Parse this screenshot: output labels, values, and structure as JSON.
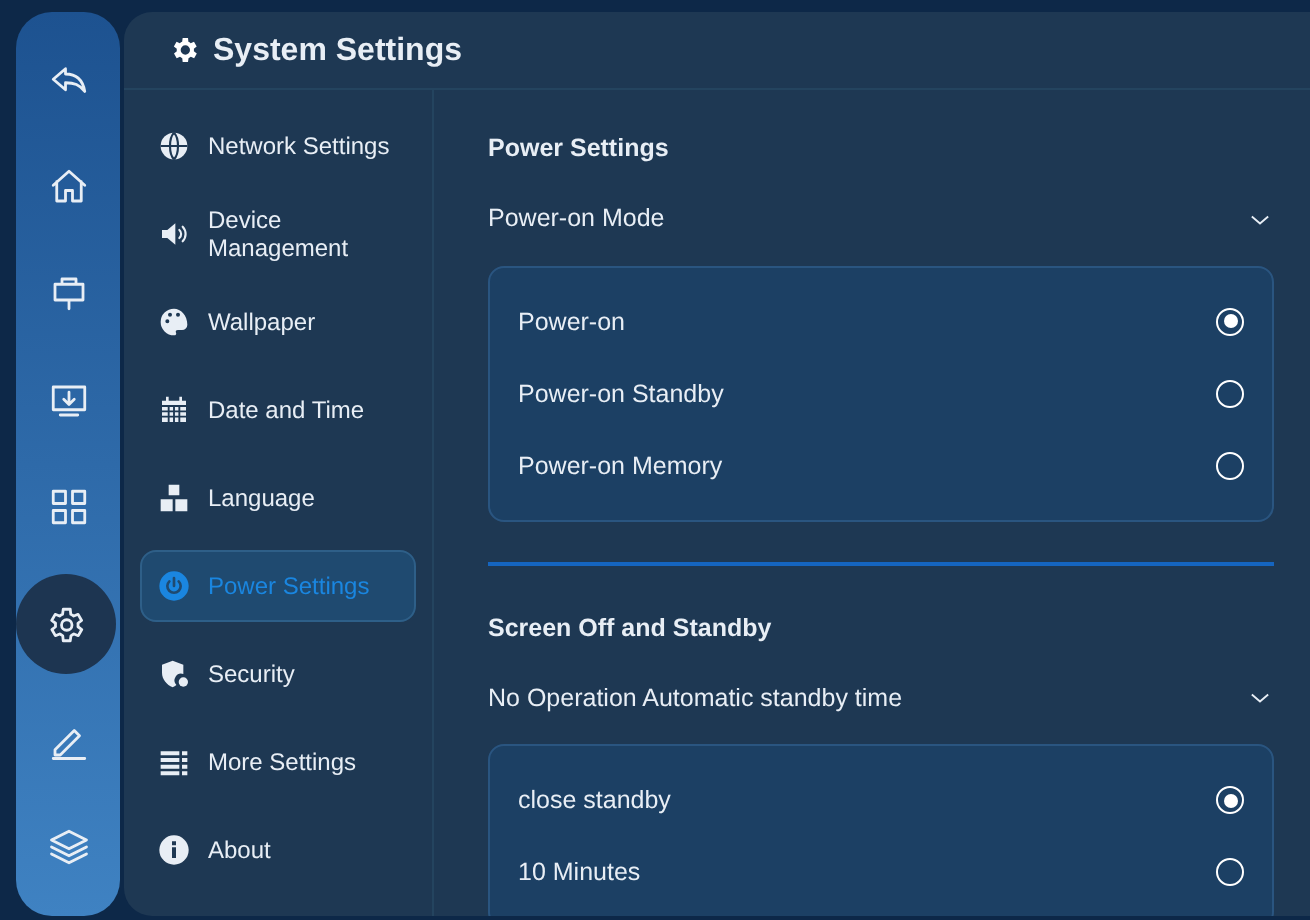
{
  "rail": [
    {
      "kind": "back",
      "selected": false
    },
    {
      "kind": "home",
      "selected": false
    },
    {
      "kind": "board",
      "selected": false
    },
    {
      "kind": "screen",
      "selected": false
    },
    {
      "kind": "apps",
      "selected": false
    },
    {
      "kind": "settings",
      "selected": true
    },
    {
      "kind": "pen",
      "selected": false
    },
    {
      "kind": "layers",
      "selected": false
    }
  ],
  "header": {
    "title": "System Settings"
  },
  "menu": [
    {
      "kind": "globe",
      "label": "Network Settings",
      "selected": false
    },
    {
      "kind": "speaker",
      "label": "Device Management",
      "selected": false
    },
    {
      "kind": "palette",
      "label": "Wallpaper",
      "selected": false
    },
    {
      "kind": "calendar",
      "label": "Date and Time",
      "selected": false
    },
    {
      "kind": "language",
      "label": "Language",
      "selected": false
    },
    {
      "kind": "power",
      "label": "Power Settings",
      "selected": true
    },
    {
      "kind": "shield",
      "label": "Security",
      "selected": false
    },
    {
      "kind": "list",
      "label": "More Settings",
      "selected": false
    },
    {
      "kind": "info",
      "label": "About",
      "selected": false
    }
  ],
  "sections": [
    {
      "title": "Power Settings",
      "dropdown": "Power-on Mode",
      "options": [
        {
          "label": "Power-on",
          "selected": true
        },
        {
          "label": "Power-on Standby",
          "selected": false
        },
        {
          "label": "Power-on Memory",
          "selected": false
        }
      ]
    },
    {
      "title": "Screen Off and Standby",
      "dropdown": "No Operation Automatic standby time",
      "options": [
        {
          "label": "close standby",
          "selected": true
        },
        {
          "label": "10 Minutes",
          "selected": false
        }
      ]
    }
  ]
}
